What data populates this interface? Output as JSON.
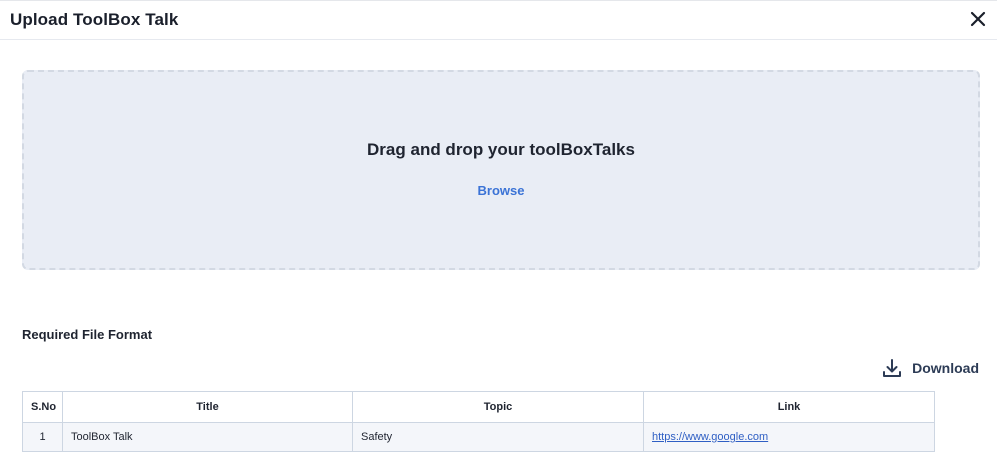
{
  "dialog": {
    "title": "Upload ToolBox Talk",
    "close_icon": "close-icon"
  },
  "dropzone": {
    "prompt": "Drag and drop your toolBoxTalks",
    "browse_label": "Browse"
  },
  "format_section": {
    "label": "Required File Format",
    "download_label": "Download",
    "download_icon": "download-icon"
  },
  "table": {
    "headers": [
      "S.No",
      "Title",
      "Topic",
      "Link"
    ],
    "rows": [
      {
        "sno": "1",
        "title": "ToolBox Talk",
        "topic": "Safety",
        "link": "https://www.google.com"
      }
    ]
  },
  "colors": {
    "accent": "#3b73d6",
    "dropzone_bg": "#e9edf5",
    "border": "#cdd6e2"
  }
}
